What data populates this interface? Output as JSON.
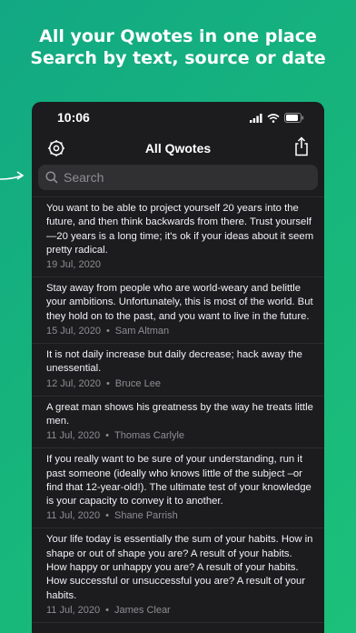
{
  "promo": {
    "line1": "All your Qwotes in one place",
    "line2": "Search by text, source or date"
  },
  "status": {
    "time": "10:06"
  },
  "nav": {
    "title": "All Qwotes"
  },
  "search": {
    "placeholder": "Search",
    "value": ""
  },
  "colors": {
    "accent_green": "#16b47c",
    "background": "#1c1c1e",
    "text": "#f2f2f7",
    "secondary": "#8e8e93"
  },
  "icons": [
    "arrow-right-icon",
    "settings-icon",
    "share-icon",
    "search-icon",
    "signal-icon",
    "wifi-icon",
    "battery-icon"
  ],
  "quotes": [
    {
      "text": "You want to be able to project yourself 20 years into the future, and then think backwards from there. Trust yourself—20 years is a long time; it's ok if your ideas about it seem pretty radical.",
      "date": "19 Jul, 2020",
      "source": ""
    },
    {
      "text": "Stay away from people who are world-weary and belittle your ambitions. Unfortunately, this is most of the world. But they hold on to the past, and you want to live in the future.",
      "date": "15 Jul, 2020",
      "source": "Sam Altman"
    },
    {
      "text": "It is not daily increase but daily decrease; hack away the unessential.",
      "date": "12 Jul, 2020",
      "source": "Bruce Lee"
    },
    {
      "text": "A great man shows his greatness by the way he treats little men.",
      "date": "11 Jul, 2020",
      "source": "Thomas Carlyle"
    },
    {
      "text": "If you really want to be sure of your understanding, run it past someone (ideally who knows little of the subject –or find that 12-year-old!). The ultimate test of your knowledge is your capacity to convey it to another.",
      "date": "11 Jul, 2020",
      "source": "Shane Parrish"
    },
    {
      "text": "Your life today is essentially the sum of your habits. How in shape or out of shape you are? A result of your habits. How happy or unhappy you are? A result of your habits. How successful or unsuccessful you are? A result of your habits.",
      "date": "11 Jul, 2020",
      "source": "James Clear"
    }
  ]
}
